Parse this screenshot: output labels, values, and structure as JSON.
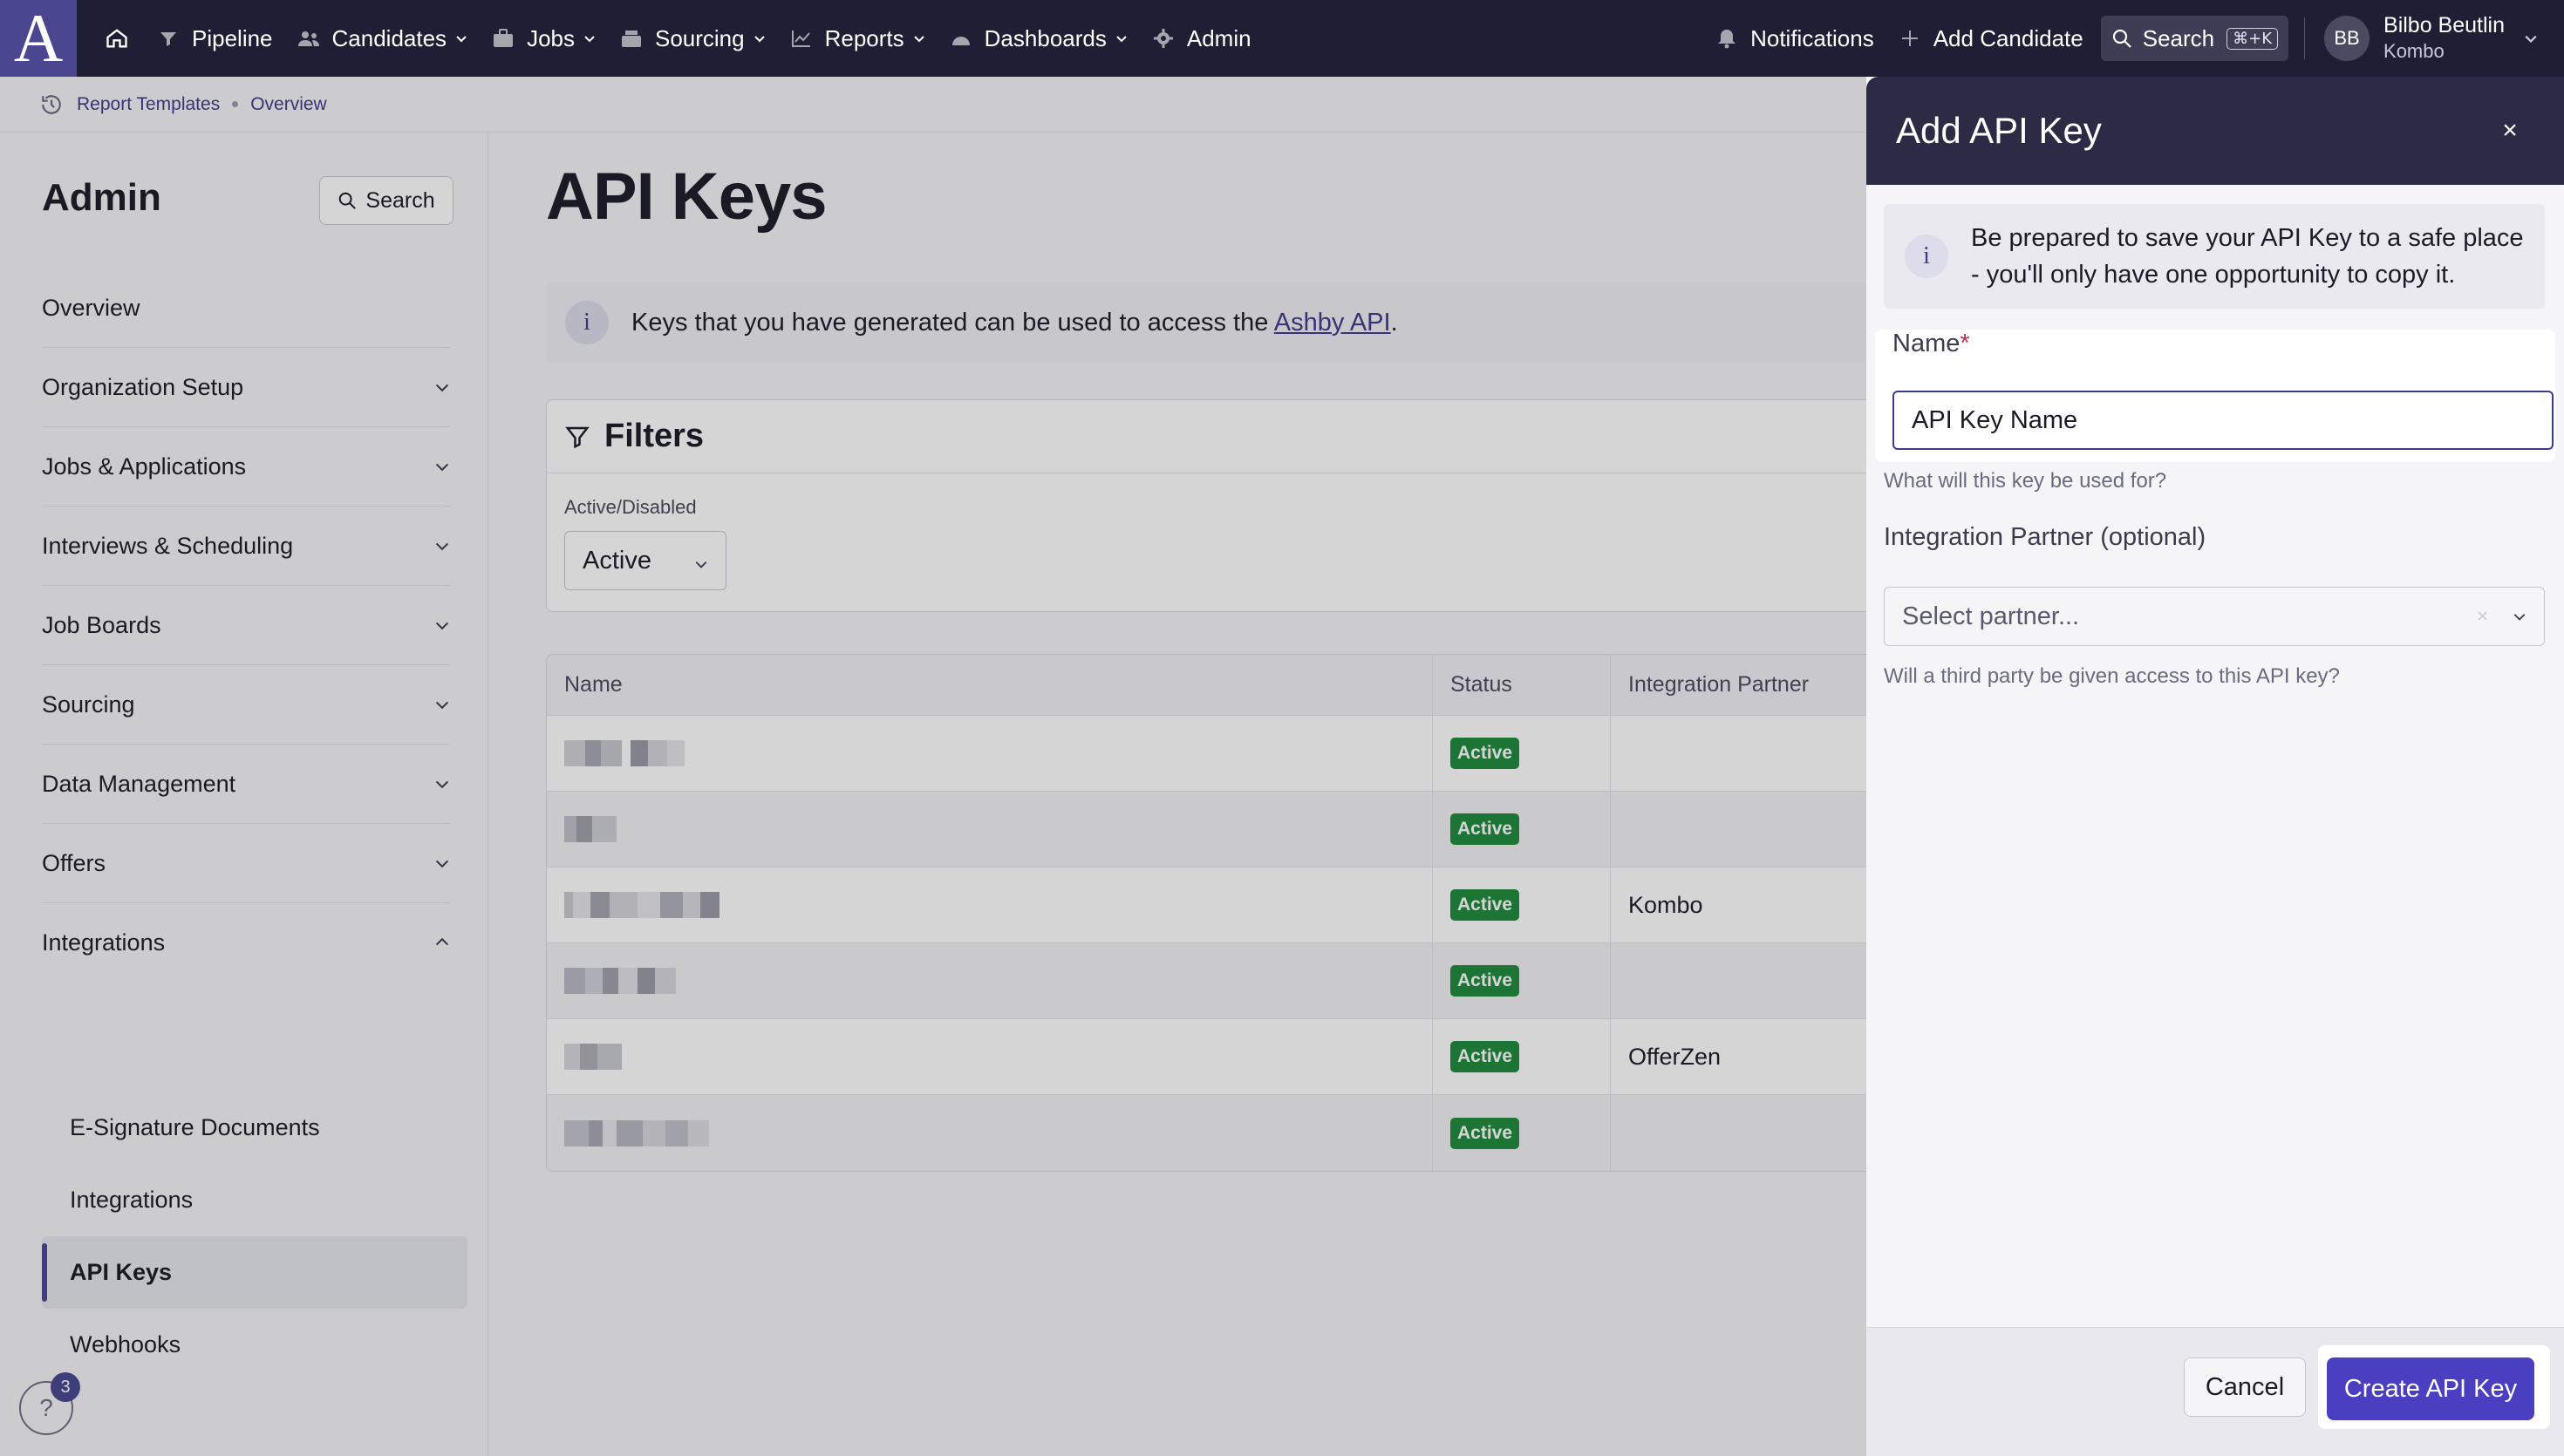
{
  "topnav": {
    "logo": "A",
    "items": [
      {
        "label": "Pipeline",
        "dropdown": false
      },
      {
        "label": "Candidates",
        "dropdown": true
      },
      {
        "label": "Jobs",
        "dropdown": true
      },
      {
        "label": "Sourcing",
        "dropdown": true
      },
      {
        "label": "Reports",
        "dropdown": true
      },
      {
        "label": "Dashboards",
        "dropdown": true
      },
      {
        "label": "Admin",
        "dropdown": false
      }
    ],
    "notifications": "Notifications",
    "add_candidate": "Add Candidate",
    "search": "Search",
    "search_shortcut": "⌘+K",
    "user": {
      "initials": "BB",
      "name": "Bilbo Beutlin",
      "org": "Kombo"
    }
  },
  "breadcrumb": {
    "items": [
      "Report Templates",
      "Overview"
    ]
  },
  "sidebar": {
    "title": "Admin",
    "search_label": "Search",
    "items": [
      {
        "label": "Overview",
        "expandable": false
      },
      {
        "label": "Organization Setup",
        "expandable": true
      },
      {
        "label": "Jobs & Applications",
        "expandable": true
      },
      {
        "label": "Interviews & Scheduling",
        "expandable": true
      },
      {
        "label": "Job Boards",
        "expandable": true
      },
      {
        "label": "Sourcing",
        "expandable": true
      },
      {
        "label": "Data Management",
        "expandable": true
      },
      {
        "label": "Offers",
        "expandable": true
      },
      {
        "label": "Integrations",
        "expandable": true,
        "expanded": true
      }
    ],
    "sub_items": [
      {
        "label": "E-Signature Documents"
      },
      {
        "label": "Integrations"
      },
      {
        "label": "API Keys",
        "active": true
      },
      {
        "label": "Webhooks"
      }
    ],
    "help_badge": "3"
  },
  "main": {
    "title": "API Keys",
    "info_text": "Keys that you have generated can be used to access the ",
    "info_link": "Ashby API",
    "info_suffix": ".",
    "filters": {
      "title": "Filters",
      "label": "Active/Disabled",
      "value": "Active"
    },
    "table": {
      "columns": [
        "Name",
        "Status",
        "Integration Partner"
      ],
      "rows": [
        {
          "status": "Active",
          "partner": ""
        },
        {
          "status": "Active",
          "partner": ""
        },
        {
          "status": "Active",
          "partner": "Kombo"
        },
        {
          "status": "Active",
          "partner": ""
        },
        {
          "status": "Active",
          "partner": "OfferZen"
        },
        {
          "status": "Active",
          "partner": ""
        }
      ]
    }
  },
  "drawer": {
    "title": "Add API Key",
    "close": "×",
    "banner": "Be prepared to save your API Key to a safe place - you'll only have one opportunity to copy it.",
    "name_label": "Name",
    "required_mark": "*",
    "name_value": "API Key Name",
    "name_hint": "What will this key be used for?",
    "partner_label": "Integration Partner (optional)",
    "partner_placeholder": "Select partner...",
    "partner_hint": "Will a third party be given access to this API key?",
    "cancel": "Cancel",
    "create": "Create API Key"
  },
  "colors": {
    "nav_bg": "#1e1e35",
    "accent": "#4a3fc0",
    "active_badge": "#1f8a3b"
  }
}
